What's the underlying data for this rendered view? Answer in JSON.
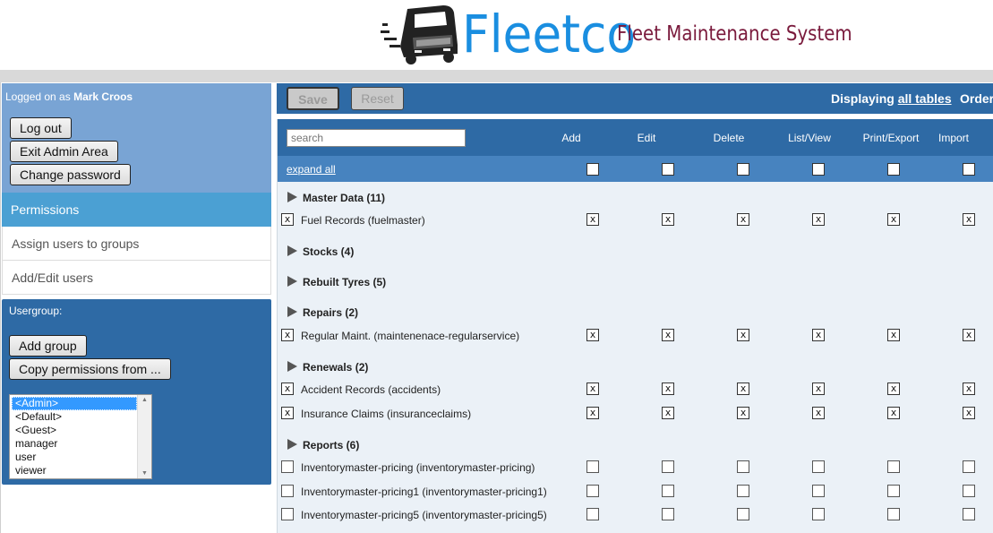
{
  "header": {
    "brand": "Fleetco",
    "tagline": "Fleet Maintenance System"
  },
  "login": {
    "prefix": "Logged on as ",
    "user": "Mark Croos",
    "buttons": {
      "logout": "Log out",
      "exit_admin": "Exit Admin Area",
      "change_password": "Change password"
    }
  },
  "nav": {
    "permissions": "Permissions",
    "assign_users": "Assign users to groups",
    "add_edit_users": "Add/Edit users"
  },
  "usergroup": {
    "label": "Usergroup:",
    "add_group": "Add group",
    "copy_permissions": "Copy permissions from ...",
    "options": [
      "<Admin>",
      "<Default>",
      "<Guest>",
      "manager",
      "user",
      "viewer"
    ],
    "selected": "<Admin>"
  },
  "toolbar": {
    "save": "Save",
    "reset": "Reset",
    "displaying_prefix": "Displaying ",
    "displaying_link": "all tables",
    "order": "Order"
  },
  "table": {
    "search_placeholder": "search",
    "columns": [
      "Add",
      "Edit",
      "Delete",
      "List/View",
      "Print/Export",
      "Import"
    ],
    "expand_all": "expand all",
    "rows": [
      {
        "type": "group",
        "title": "Master Data (11)"
      },
      {
        "type": "item",
        "label": "Fuel Records (fuelmaster)",
        "checked": true,
        "perms": [
          true,
          true,
          true,
          true,
          true,
          true
        ]
      },
      {
        "type": "group",
        "title": "Stocks (4)"
      },
      {
        "type": "group",
        "title": "Rebuilt Tyres (5)"
      },
      {
        "type": "group",
        "title": "Repairs (2)"
      },
      {
        "type": "item",
        "label": "Regular Maint. (maintenenace-regularservice)",
        "checked": true,
        "perms": [
          true,
          true,
          true,
          true,
          true,
          true
        ]
      },
      {
        "type": "group",
        "title": "Renewals (2)"
      },
      {
        "type": "item",
        "label": "Accident Records (accidents)",
        "checked": true,
        "perms": [
          true,
          true,
          true,
          true,
          true,
          true
        ]
      },
      {
        "type": "item",
        "label": "Insurance Claims (insuranceclaims)",
        "checked": true,
        "perms": [
          true,
          true,
          true,
          true,
          true,
          true
        ]
      },
      {
        "type": "group",
        "title": "Reports (6)"
      },
      {
        "type": "item",
        "label": "Inventorymaster-pricing (inventorymaster-pricing)",
        "checked": false,
        "perms": [
          false,
          false,
          false,
          false,
          false,
          false
        ]
      },
      {
        "type": "item",
        "label": "Inventorymaster-pricing1 (inventorymaster-pricing1)",
        "checked": false,
        "perms": [
          false,
          false,
          false,
          false,
          false,
          false
        ]
      },
      {
        "type": "item",
        "label": "Inventorymaster-pricing5 (inventorymaster-pricing5)",
        "checked": false,
        "perms": [
          false,
          false,
          false,
          false,
          false,
          false
        ]
      }
    ]
  },
  "colors": {
    "brand_blue": "#1a8ee0",
    "tagline": "#7a1a3c",
    "panel_dark": "#2e6aa5",
    "panel_light": "#79a4d4",
    "nav_active": "#4ba0d3"
  }
}
